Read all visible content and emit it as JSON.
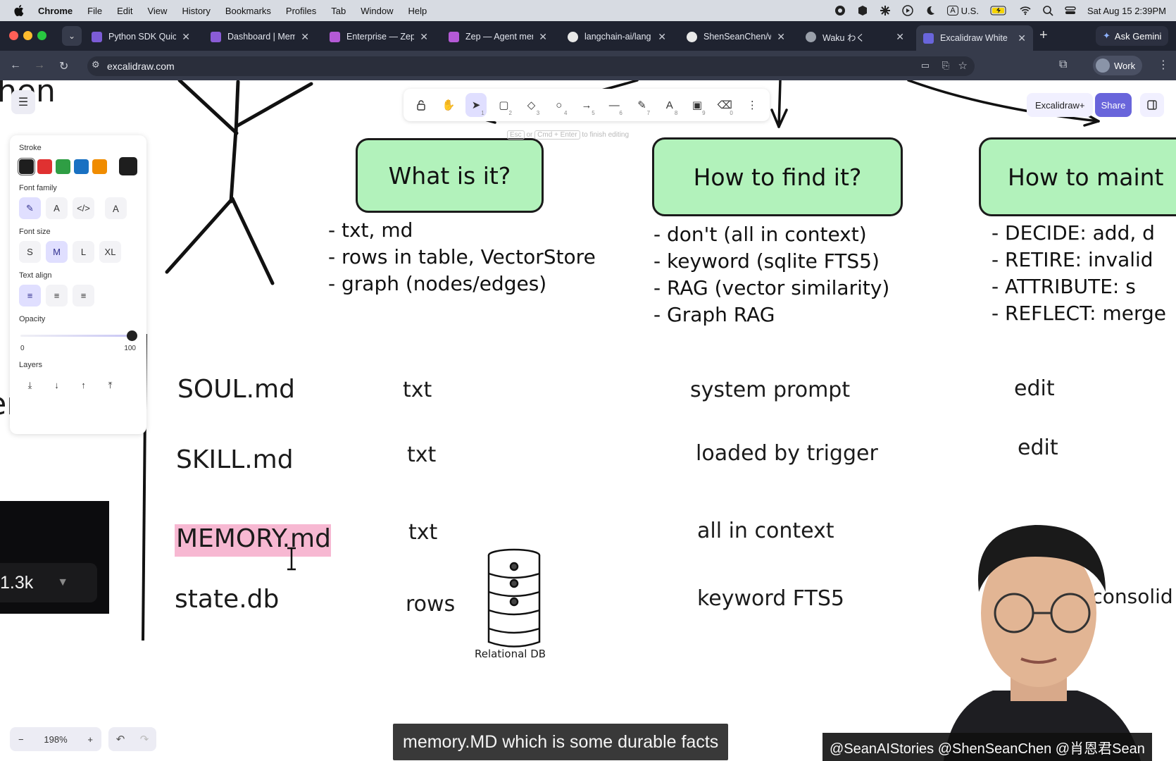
{
  "menubar": {
    "app": "Chrome",
    "items": [
      "File",
      "Edit",
      "View",
      "History",
      "Bookmarks",
      "Profiles",
      "Tab",
      "Window",
      "Help"
    ],
    "input_source": "U.S.",
    "clock": "Sat Aug 15  2:39PM"
  },
  "tabs": [
    {
      "label": "Python SDK Quick",
      "color": "#7c5cd6"
    },
    {
      "label": "Dashboard | Mem",
      "color": "#8a5cd6"
    },
    {
      "label": "Enterprise — Zep",
      "color": "#b45ad6"
    },
    {
      "label": "Zep — Agent mem",
      "color": "#b45ad6"
    },
    {
      "label": "langchain-ai/lang",
      "color": "#e8e8e8"
    },
    {
      "label": "ShenSeanChen/w",
      "color": "#e8e8e8"
    },
    {
      "label": "Waku わく",
      "color": "#9aa0aa"
    },
    {
      "label": "Excalidraw White",
      "color": "#6965db"
    }
  ],
  "ask_gemini": "Ask Gemini",
  "address": {
    "url": "excalidraw.com",
    "profile": "Work"
  },
  "toolbar": {
    "hint_key1": "Esc",
    "hint_or": "or",
    "hint_key2": "Cmd + Enter",
    "hint_tail": "to finish editing",
    "shortcuts": [
      "1",
      "2",
      "3",
      "4",
      "5",
      "6",
      "7",
      "8",
      "9",
      "0"
    ]
  },
  "top_right": {
    "excalidraw_plus": "Excalidraw+",
    "share": "Share"
  },
  "props": {
    "stroke_label": "Stroke",
    "stroke_colors": [
      "#1e1e1e",
      "#e03131",
      "#2f9e44",
      "#1971c2",
      "#f08c00"
    ],
    "current_stroke": "#1e1e1e",
    "font_family_label": "Font family",
    "font_size_label": "Font size",
    "font_sizes": [
      "S",
      "M",
      "L",
      "XL"
    ],
    "selected_font_size": "M",
    "text_align_label": "Text align",
    "opacity_label": "Opacity",
    "opacity_min": "0",
    "opacity_max": "100",
    "opacity_value": 100,
    "layers_label": "Layers"
  },
  "canvas": {
    "left_fragment_top": "hen",
    "left_fragment_mid": "lemes",
    "headers": [
      "What is it?",
      "How to find it?",
      "How to maint"
    ],
    "bullets_what": [
      "- txt, md",
      "- rows in table, VectorStore",
      "- graph (nodes/edges)"
    ],
    "bullets_find": [
      "- don't (all in context)",
      "- keyword (sqlite FTS5)",
      "- RAG (vector similarity)",
      "- Graph RAG"
    ],
    "bullets_maint": [
      "- DECIDE: add, d",
      "- RETIRE: invalid",
      "- ATTRIBUTE: s",
      "- REFLECT: merge"
    ],
    "rows": [
      {
        "file": "SOUL.md",
        "type": "txt",
        "find": "system prompt",
        "maint": "edit"
      },
      {
        "file": "SKILL.md",
        "type": "txt",
        "find": "loaded by trigger",
        "maint": "edit"
      },
      {
        "file": "MEMORY.md",
        "type": "txt",
        "find": "all in context",
        "maint": ""
      },
      {
        "file": "state.db",
        "type": "rows",
        "find": "keyword FTS5",
        "maint": "+ consolid"
      }
    ],
    "db_label": "Relational DB"
  },
  "zoom": {
    "minus": "−",
    "value": "198%",
    "plus": "+"
  },
  "overlay": {
    "stat": "1.3k"
  },
  "video": {
    "subtitle": "memory.MD which is some durable facts",
    "handles": "@SeanAIStories @ShenSeanChen @肖恩君Sean"
  }
}
